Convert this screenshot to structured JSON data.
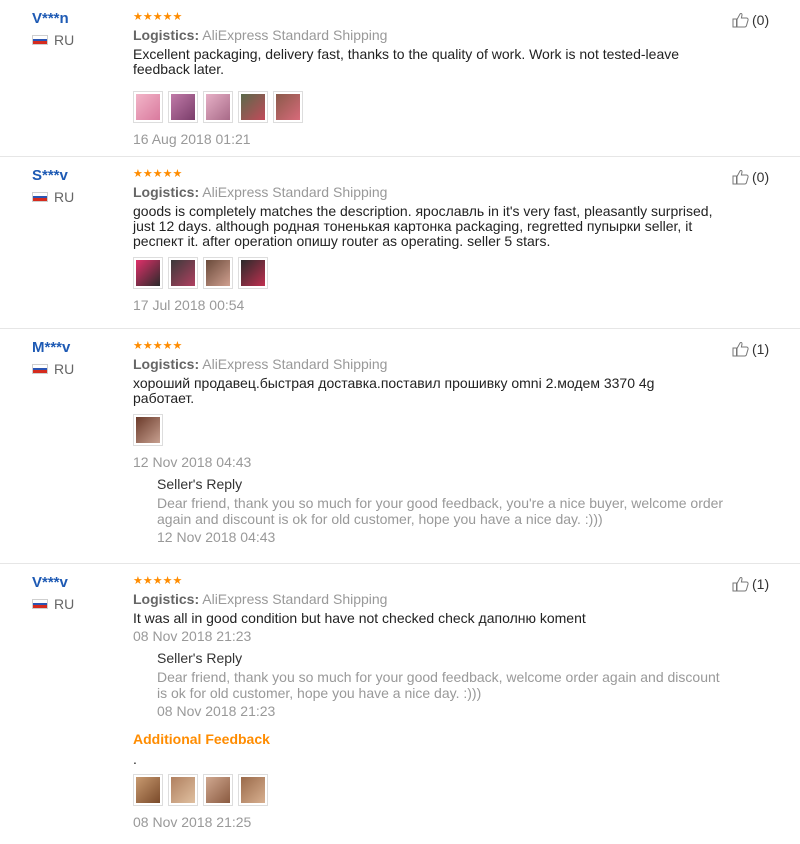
{
  "reviews": [
    {
      "name": "V***n",
      "country": "RU",
      "stars": "★★★★★",
      "logistics_label": "Logistics:",
      "logistics_value": "AliExpress Standard Shipping",
      "text": "Excellent packaging, delivery fast, thanks to the quality of work. Work is not tested-leave feedback later.",
      "helpful": "(0)",
      "date": "16 Aug 2018 01:21"
    },
    {
      "name": "S***v",
      "country": "RU",
      "stars": "★★★★★",
      "logistics_label": "Logistics:",
      "logistics_value": "AliExpress Standard Shipping",
      "text": "goods is completely matches the description. ярославль in it's very fast, pleasantly surprised, just 12 days. although родная тоненькая картонка packaging, regretted пупырки seller, it респект it. after operation опишу router as operating. seller 5 stars.",
      "helpful": "(0)",
      "date": "17 Jul 2018 00:54"
    },
    {
      "name": "M***v",
      "country": "RU",
      "stars": "★★★★★",
      "logistics_label": "Logistics:",
      "logistics_value": "AliExpress Standard Shipping",
      "text": "хороший продавец.быстрая доставка.поставил прошивку omni 2.модем 3370 4g работает.",
      "helpful": "(1)",
      "date": "12 Nov 2018 04:43",
      "reply_title": "Seller's Reply",
      "reply_text": "Dear friend, thank you so much for your good feedback, you're a nice buyer, welcome order again and discount is ok for old customer, hope you have a nice day. :)))",
      "reply_date": "12 Nov 2018 04:43"
    },
    {
      "name": "V***v",
      "country": "RU",
      "stars": "★★★★★",
      "logistics_label": "Logistics:",
      "logistics_value": "AliExpress Standard Shipping",
      "text": "It was all in good condition but have not checked check даполню koment",
      "helpful": "(1)",
      "date": "08 Nov 2018 21:23",
      "reply_title": "Seller's Reply",
      "reply_text": "Dear friend, thank you so much for your good feedback, welcome order again and discount is ok for old customer, hope you have a nice day. :)))",
      "reply_date": "08 Nov 2018 21:23",
      "additional_title": "Additional Feedback",
      "additional_text": ".",
      "additional_date": "08 Nov 2018 21:25"
    }
  ],
  "icons": {
    "like": "thumbs-up-icon",
    "rating": "star-icon",
    "flag": "russia-flag-icon"
  },
  "colors": {
    "username": "#1e5ab4",
    "stars": "#ff8c00",
    "additional": "#ff8c00",
    "muted": "#999999"
  }
}
